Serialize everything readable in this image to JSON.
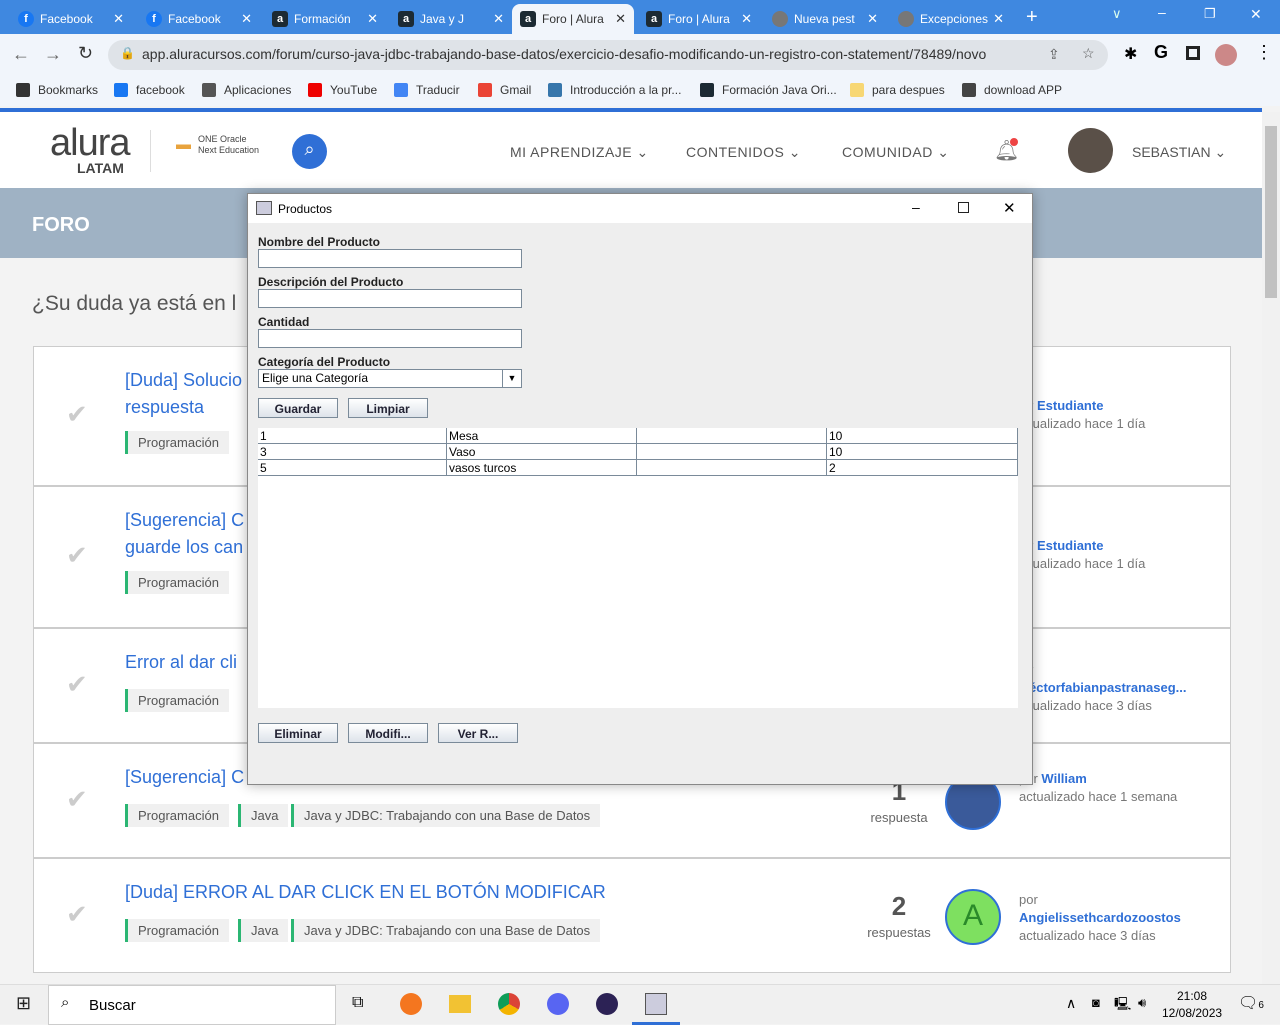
{
  "browser": {
    "tabs": [
      {
        "label": "Facebook",
        "icon": "facebook-icon"
      },
      {
        "label": "Facebook",
        "icon": "facebook-icon"
      },
      {
        "label": "Formación",
        "icon": "alura-icon"
      },
      {
        "label": "Java y J",
        "icon": "alura-icon"
      },
      {
        "label": "Foro | Alura",
        "icon": "alura-icon",
        "active": true
      },
      {
        "label": "Foro | Alura",
        "icon": "alura-icon"
      },
      {
        "label": "Nueva pest",
        "icon": "chrome-icon"
      },
      {
        "label": "Excepciones",
        "icon": "globe-icon"
      }
    ],
    "url": "app.aluracursos.com/forum/curso-java-jdbc-trabajando-base-datos/exercicio-desafio-modificando-un-registro-con-statement/78489/novo",
    "bookmarks": [
      "Bookmarks",
      "facebook",
      "Aplicaciones",
      "YouTube",
      "Traducir",
      "Gmail",
      "Introducción a la pr...",
      "Formación Java Ori...",
      "para despues",
      "download APP"
    ]
  },
  "site": {
    "logo": "alura LATAM",
    "partner": "ONE Oracle Next Education",
    "nav": [
      "MI APRENDIZAJE",
      "CONTENIDOS",
      "COMUNIDAD"
    ],
    "user": "SEBASTIAN",
    "band": "FORO",
    "question": "¿Su duda ya está en l",
    "topics": [
      {
        "title": "[Duda] Solucio",
        "title2": "respuesta",
        "tags": [
          "Programación"
        ],
        "by": "r",
        "author": "Estudiante",
        "updated": "tualizado hace 1 día"
      },
      {
        "title": "[Sugerencia] C",
        "title2": "guarde los can",
        "tags": [
          "Programación"
        ],
        "by": "r",
        "author": "Estudiante",
        "updated": "tualizado hace 1 día"
      },
      {
        "title": "Error al dar cli",
        "tags": [
          "Programación"
        ],
        "by": "r",
        "author": "éctorfabianpastranaseg...",
        "updated": "tualizado hace 3 días"
      },
      {
        "title": "[Sugerencia] C",
        "tags": [
          "Programación",
          "Java",
          "Java y JDBC: Trabajando con una Base de Datos"
        ],
        "count": "1",
        "count_label": "respuesta",
        "by": "por",
        "author": "William",
        "updated": "actualizado hace 1 semana"
      },
      {
        "title": "[Duda] ERROR AL DAR CLICK EN EL BOTÓN MODIFICAR",
        "tags": [
          "Programación",
          "Java",
          "Java y JDBC: Trabajando con una Base de Datos"
        ],
        "count": "2",
        "count_label": "respuestas",
        "by": "por",
        "author": "Angielissethcardozoostos",
        "updated": "actualizado hace 3 días",
        "avatar_letter": "A"
      }
    ]
  },
  "dialog": {
    "title": "Productos",
    "labels": {
      "name": "Nombre del Producto",
      "desc": "Descripción del Producto",
      "qty": "Cantidad",
      "cat": "Categoría del Producto"
    },
    "category_selected": "Elige una Categoría",
    "buttons": {
      "save": "Guardar",
      "clear": "Limpiar",
      "delete": "Eliminar",
      "modify": "Modifi...",
      "view": "Ver R..."
    },
    "rows": [
      [
        "1",
        "Mesa",
        "",
        "10"
      ],
      [
        "3",
        "Vaso",
        "",
        "10"
      ],
      [
        "5",
        "vasos turcos",
        "",
        "2"
      ]
    ]
  },
  "taskbar": {
    "search": "Buscar",
    "time": "21:08",
    "date": "12/08/2023",
    "notifications": "6"
  }
}
